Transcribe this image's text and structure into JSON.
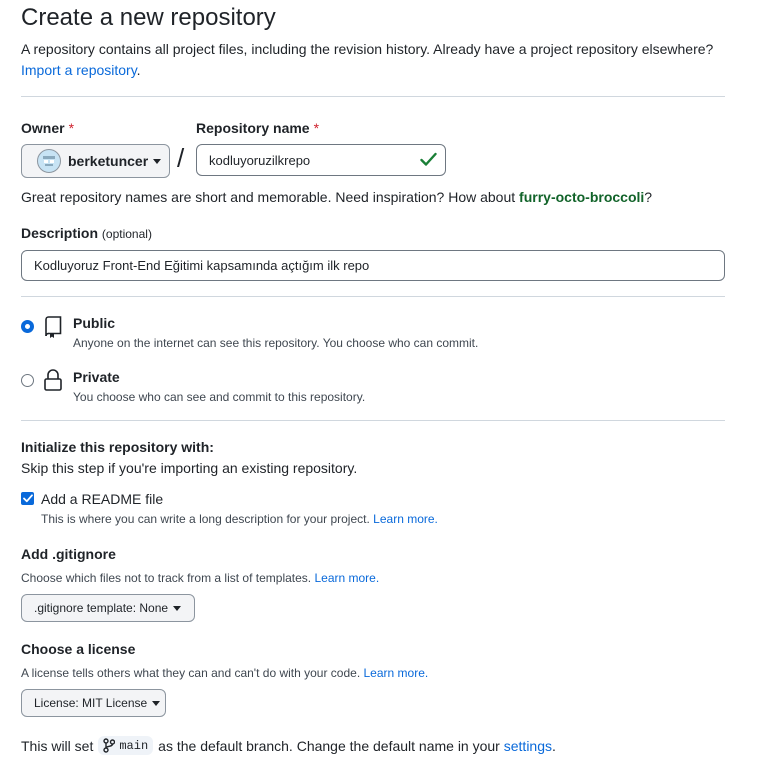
{
  "header": {
    "title": "Create a new repository",
    "subtitle": "A repository contains all project files, including the revision history. Already have a project repository elsewhere?",
    "import_link": "Import a repository",
    "import_suffix": "."
  },
  "owner": {
    "label": "Owner",
    "required_mark": "*",
    "selected": "berketuncer"
  },
  "separator": "/",
  "repo_name": {
    "label": "Repository name",
    "required_mark": "*",
    "value": "kodluyoruzilkrepo",
    "valid": true
  },
  "suggestion": {
    "text": "Great repository names are short and memorable. Need inspiration? How about",
    "name": "furry-octo-broccoli",
    "suffix": "?"
  },
  "description": {
    "label": "Description",
    "optional": "(optional)",
    "value": "Kodluyoruz Front-End Eğitimi kapsamında açtığım ilk repo"
  },
  "visibility": {
    "options": [
      {
        "label": "Public",
        "desc": "Anyone on the internet can see this repository. You choose who can commit.",
        "selected": true,
        "icon": "repo-icon"
      },
      {
        "label": "Private",
        "desc": "You choose who can see and commit to this repository.",
        "selected": false,
        "icon": "lock-icon"
      }
    ]
  },
  "init": {
    "heading": "Initialize this repository with:",
    "hint": "Skip this step if you're importing an existing repository.",
    "readme": {
      "label": "Add a README file",
      "checked": true,
      "desc": "This is where you can write a long description for your project.",
      "learn_more": "Learn more."
    }
  },
  "gitignore": {
    "heading": "Add .gitignore",
    "desc": "Choose which files not to track from a list of templates.",
    "learn_more": "Learn more.",
    "button": ".gitignore template: None"
  },
  "license": {
    "heading": "Choose a license",
    "desc": "A license tells others what they can and can't do with your code.",
    "learn_more": "Learn more.",
    "button": "License: MIT License"
  },
  "branch": {
    "prefix": "This will set",
    "name": "main",
    "middle": "as the default branch. Change the default name in your",
    "settings_link": "settings",
    "suffix": "."
  },
  "colors": {
    "accent": "#0969da",
    "danger": "#cf222e",
    "success_green": "#1a7f37",
    "suggestion_green": "#116329"
  }
}
